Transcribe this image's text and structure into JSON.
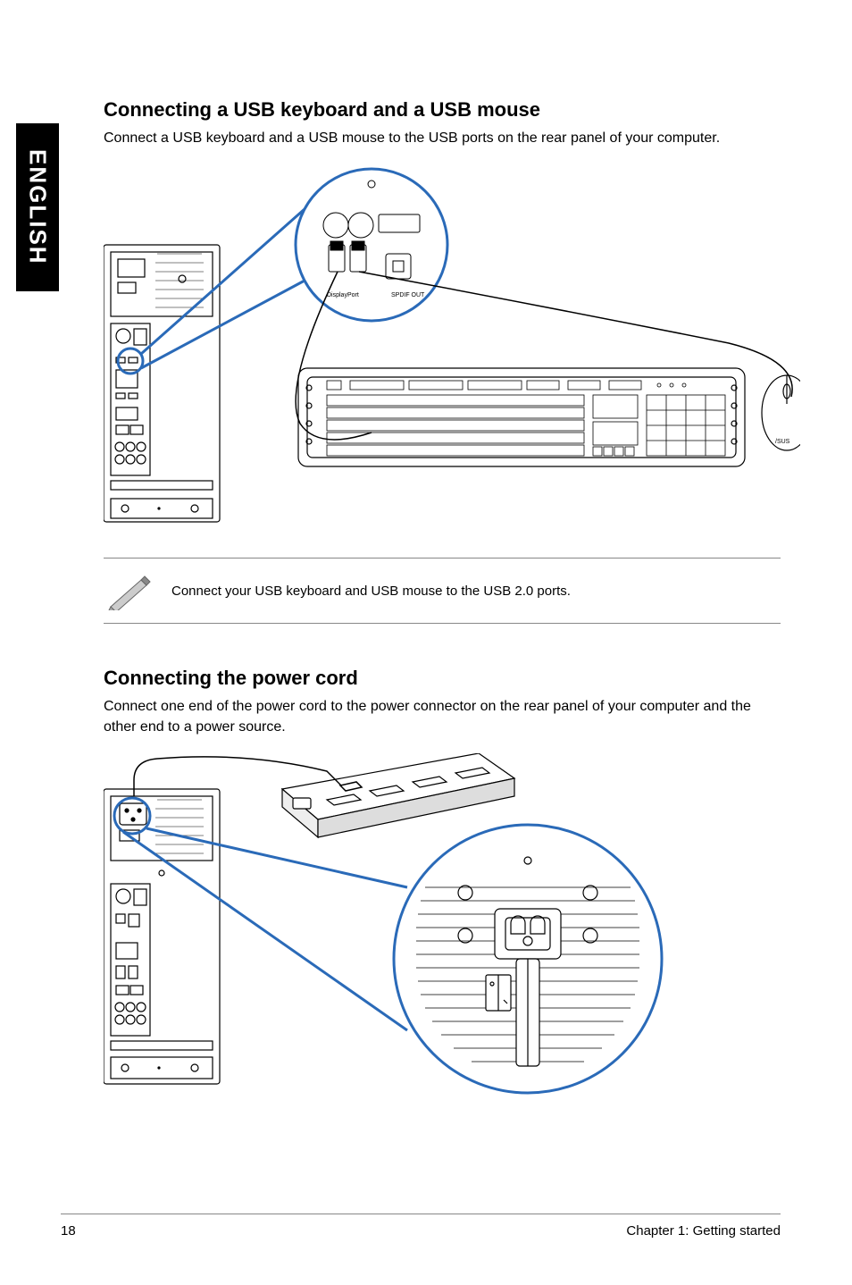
{
  "sideTab": "ENGLISH",
  "section1": {
    "heading": "Connecting a USB keyboard and a USB mouse",
    "body": "Connect a USB keyboard and a USB mouse to the USB ports on the rear panel of your computer.",
    "noteText": "Connect your USB keyboard and USB mouse to the USB 2.0 ports."
  },
  "section2": {
    "heading": "Connecting the power cord",
    "body": "Connect one end of the power cord to the power connector on the rear panel of your computer and the other end to a power source."
  },
  "footer": {
    "pageNumber": "18",
    "chapter": "Chapter 1: Getting started"
  }
}
